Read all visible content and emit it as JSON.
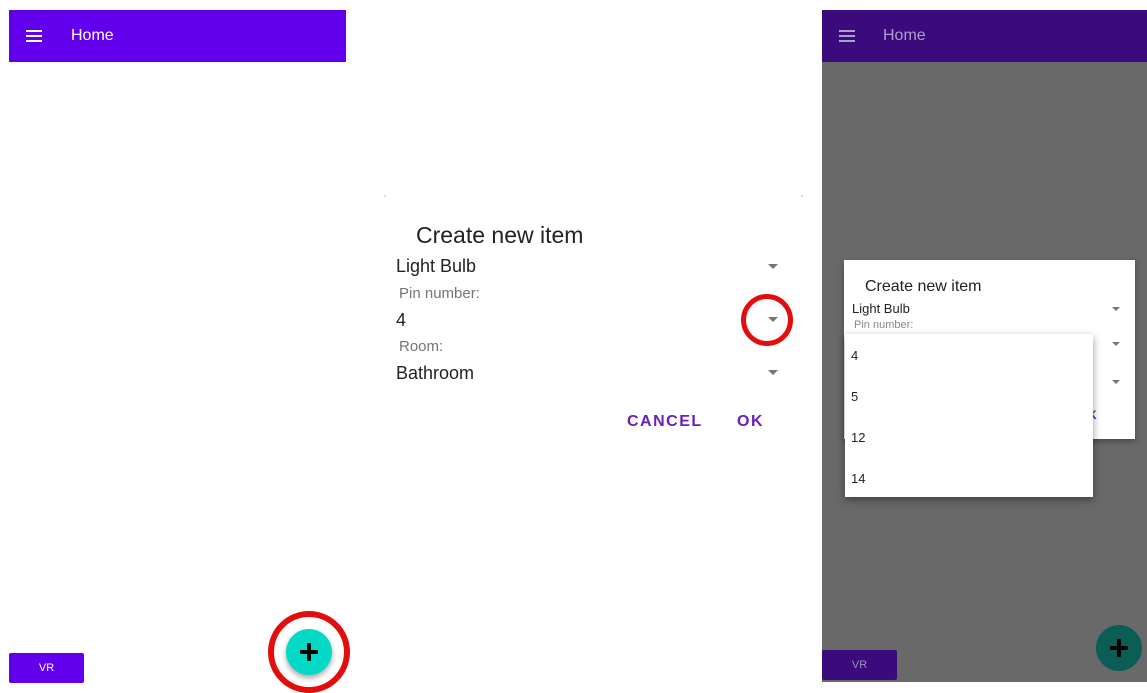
{
  "colors": {
    "primary": "#6200ee",
    "primary_dimmed": "#3b0a7c",
    "accent": "#03dac5",
    "accent_dimmed": "#0b5e56",
    "dialog_button": "#6a1fb5",
    "highlight_ring": "#e40d0d",
    "scrim": "#696969"
  },
  "panel1": {
    "appbar": {
      "menu_icon": "hamburger-menu-icon",
      "title": "Home"
    },
    "vr_button": "VR",
    "fab_icon": "plus-icon"
  },
  "panel2": {
    "dialog": {
      "title": "Create new item",
      "device_type": "Light Bulb",
      "pin_label": "Pin number:",
      "pin_value": "4",
      "room_label": "Room:",
      "room_value": "Bathroom",
      "cancel": "CANCEL",
      "ok": "OK",
      "dropdown_icon": "dropdown-caret-icon"
    }
  },
  "panel3": {
    "appbar": {
      "menu_icon": "hamburger-menu-icon",
      "title": "Home"
    },
    "dialog": {
      "title": "Create new item",
      "device_type": "Light Bulb",
      "pin_label": "Pin number:",
      "ok_partial": "K"
    },
    "pin_options": [
      "4",
      "5",
      "12",
      "14"
    ],
    "vr_button": "VR",
    "fab_icon": "plus-icon"
  }
}
